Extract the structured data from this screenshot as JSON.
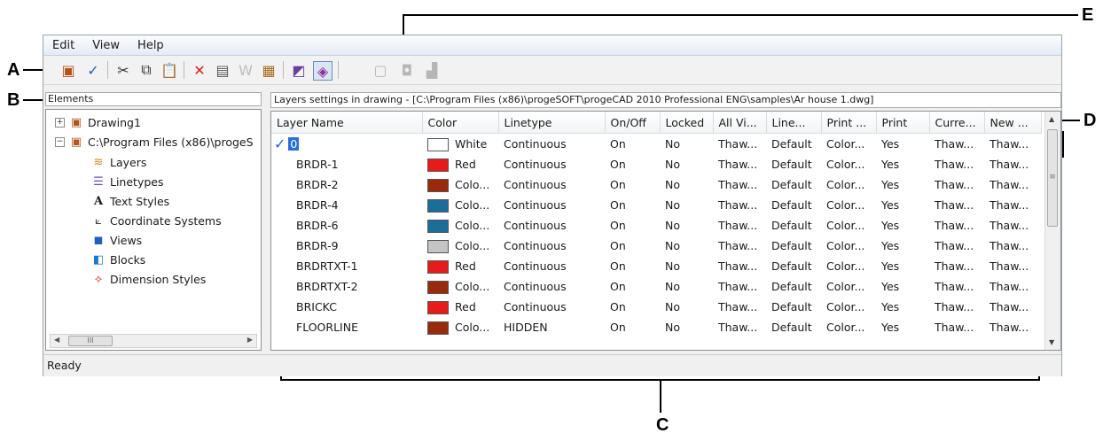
{
  "callouts": [
    "A",
    "B",
    "C",
    "D",
    "E"
  ],
  "menu": [
    "Edit",
    "View",
    "Help"
  ],
  "toolbar_icons": [
    "new-layer-icon",
    "set-current-icon",
    "cut-icon",
    "copy-icon",
    "paste-icon",
    "delete-icon",
    "properties-icon",
    "w-icon",
    "purge-icon",
    "filter-icon",
    "show-all-icon",
    "disabled-a-icon",
    "disabled-b-icon",
    "disabled-c-icon"
  ],
  "left_panel": {
    "title": "Elements",
    "tree": {
      "drawing1": "Drawing1",
      "file_path": "C:\\Program Files (x86)\\progeS",
      "layers": "Layers",
      "linetypes": "Linetypes",
      "text_styles": "Text Styles",
      "coordinate_systems": "Coordinate Systems",
      "views": "Views",
      "blocks": "Blocks",
      "dimension_styles": "Dimension Styles"
    }
  },
  "right_panel": {
    "title": "Layers settings in drawing - [C:\\Program Files (x86)\\progeSOFT\\progeCAD 2010 Professional ENG\\samples\\Ar house 1.dwg]",
    "columns": [
      "Layer Name",
      "Color",
      "Linetype",
      "On/Off",
      "Locked",
      "All Vi...",
      "Line...",
      "Print ...",
      "Print",
      "Curre...",
      "New ..."
    ],
    "rows": [
      {
        "name": "0",
        "color_name": "White",
        "swatch": "#ffffff",
        "linetype": "Continuous",
        "on": "On",
        "locked": "No",
        "allvi": "Thaw...",
        "line": "Default",
        "printst": "Color...",
        "print": "Yes",
        "curr": "Thaw...",
        "new": "Thaw...",
        "current": true
      },
      {
        "name": "BRDR-1",
        "color_name": "Red",
        "swatch": "#e81b1b",
        "linetype": "Continuous",
        "on": "On",
        "locked": "No",
        "allvi": "Thaw...",
        "line": "Default",
        "printst": "Color...",
        "print": "Yes",
        "curr": "Thaw...",
        "new": "Thaw..."
      },
      {
        "name": "BRDR-2",
        "color_name": "Colo...",
        "swatch": "#9a2a0e",
        "linetype": "Continuous",
        "on": "On",
        "locked": "No",
        "allvi": "Thaw...",
        "line": "Default",
        "printst": "Color...",
        "print": "Yes",
        "curr": "Thaw...",
        "new": "Thaw..."
      },
      {
        "name": "BRDR-4",
        "color_name": "Colo...",
        "swatch": "#1c6e9a",
        "linetype": "Continuous",
        "on": "On",
        "locked": "No",
        "allvi": "Thaw...",
        "line": "Default",
        "printst": "Color...",
        "print": "Yes",
        "curr": "Thaw...",
        "new": "Thaw..."
      },
      {
        "name": "BRDR-6",
        "color_name": "Colo...",
        "swatch": "#1c6e9a",
        "linetype": "Continuous",
        "on": "On",
        "locked": "No",
        "allvi": "Thaw...",
        "line": "Default",
        "printst": "Color...",
        "print": "Yes",
        "curr": "Thaw...",
        "new": "Thaw..."
      },
      {
        "name": "BRDR-9",
        "color_name": "Colo...",
        "swatch": "#c4c4c4",
        "linetype": "Continuous",
        "on": "On",
        "locked": "No",
        "allvi": "Thaw...",
        "line": "Default",
        "printst": "Color...",
        "print": "Yes",
        "curr": "Thaw...",
        "new": "Thaw..."
      },
      {
        "name": "BRDRTXT-1",
        "color_name": "Red",
        "swatch": "#e81b1b",
        "linetype": "Continuous",
        "on": "On",
        "locked": "No",
        "allvi": "Thaw...",
        "line": "Default",
        "printst": "Color...",
        "print": "Yes",
        "curr": "Thaw...",
        "new": "Thaw..."
      },
      {
        "name": "BRDRTXT-2",
        "color_name": "Colo...",
        "swatch": "#9a2a0e",
        "linetype": "Continuous",
        "on": "On",
        "locked": "No",
        "allvi": "Thaw...",
        "line": "Default",
        "printst": "Color...",
        "print": "Yes",
        "curr": "Thaw...",
        "new": "Thaw..."
      },
      {
        "name": "BRICKC",
        "color_name": "Red",
        "swatch": "#e81b1b",
        "linetype": "Continuous",
        "on": "On",
        "locked": "No",
        "allvi": "Thaw...",
        "line": "Default",
        "printst": "Color...",
        "print": "Yes",
        "curr": "Thaw...",
        "new": "Thaw..."
      },
      {
        "name": "FLOORLINE",
        "color_name": "Colo...",
        "swatch": "#9a2a0e",
        "linetype": "HIDDEN",
        "on": "On",
        "locked": "No",
        "allvi": "Thaw...",
        "line": "Default",
        "printst": "Color...",
        "print": "Yes",
        "curr": "Thaw...",
        "new": "Thaw..."
      }
    ]
  },
  "status": "Ready",
  "scroll_thumb_glyph": "III"
}
